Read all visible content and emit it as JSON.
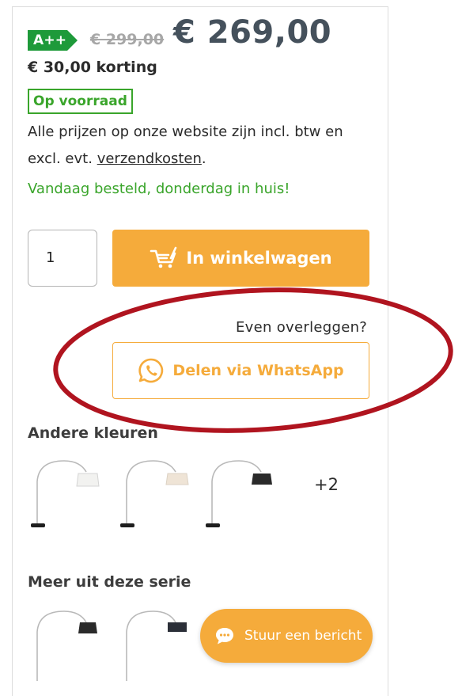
{
  "product": {
    "energy_label": "A++",
    "old_price": "€ 299,00",
    "price": "€ 269,00",
    "discount": "€ 30,00 korting",
    "stock_badge": "Op voorraad",
    "price_info_before": "Alle prijzen op onze website zijn incl. btw en excl. evt.",
    "price_info_link": "verzendkosten",
    "price_info_after": ".",
    "delivery_note": "Vandaag besteld, donderdag in huis!"
  },
  "cart": {
    "quantity": "1",
    "add_to_cart_label": "In winkelwagen"
  },
  "share": {
    "prompt": "Even overleggen?",
    "whatsapp_label": "Delen via WhatsApp"
  },
  "other_colors": {
    "title": "Andere kleuren",
    "more_count": "+2",
    "shade_colors": [
      "#f2f2f0",
      "#efe4d6",
      "#2a2a2a"
    ]
  },
  "series": {
    "title": "Meer uit deze serie",
    "shade_colors": [
      "#2a2a2a",
      "#2b2f38"
    ]
  },
  "chat": {
    "label": "Stuur een bericht"
  },
  "colors": {
    "accent": "#f5ab3b",
    "stock_green": "#3aa52b",
    "energy_green": "#1e9a3a",
    "highlight_red": "#b0141f"
  }
}
